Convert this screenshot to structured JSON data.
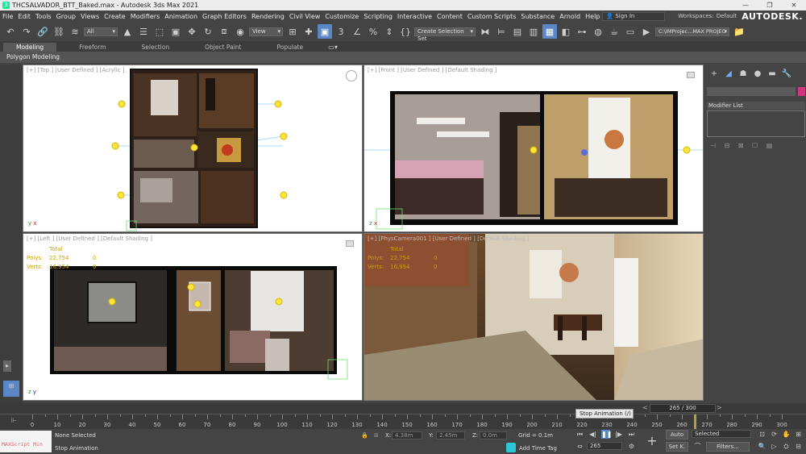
{
  "title": "THCSALVADOR_BTT_Baked.max - Autodesk 3ds Max 2021",
  "menu": [
    "File",
    "Edit",
    "Tools",
    "Group",
    "Views",
    "Create",
    "Modifiers",
    "Animation",
    "Graph Editors",
    "Rendering",
    "Civil View",
    "Customize",
    "Scripting",
    "Interactive",
    "Content",
    "Custom Scripts",
    "Substance",
    "Arnold",
    "Help"
  ],
  "sign_in": "Sign In",
  "workspaces_label": "Workspaces:",
  "workspace_value": "Default",
  "brand": "AUTODESK.",
  "toolbar": {
    "filter_value": "All",
    "ref_coord": "View",
    "selection_set": "Create Selection Set",
    "project_path": "C:\\IMProjec...MAX PROJEC"
  },
  "ribbon_tabs": [
    "Modeling",
    "Freeform",
    "Selection",
    "Object Paint",
    "Populate"
  ],
  "ribbon_sub": "Polygon Modeling",
  "viewports": {
    "top": "[+] [Top ] [User Defined ] [Acrylic ]",
    "front": "[+] [Front ] [User Defined ] [Default Shading ]",
    "left": "[+] [Left ] [User Defined ] [Default Shading ]",
    "camera": "[+] [PhysCamera001 ] [User Defined ] [Default Shading ]"
  },
  "stats": {
    "total_label": "Total",
    "polys_label": "Polys:",
    "polys": "22,754",
    "polys_sel": "0",
    "verts_label": "Verts:",
    "verts": "16,954",
    "verts_sel": "0"
  },
  "command_panel": {
    "modifier_list": "Modifier List"
  },
  "time": {
    "frame_display": "265 / 300",
    "current_frame": "265",
    "ticks": [
      "0",
      "10",
      "20",
      "30",
      "40",
      "50",
      "60",
      "70",
      "80",
      "90",
      "100",
      "110",
      "120",
      "130",
      "140",
      "150",
      "160",
      "170",
      "180",
      "190",
      "200",
      "210",
      "220",
      "230",
      "240",
      "250",
      "260",
      "270",
      "280",
      "290",
      "300"
    ],
    "frame": 265,
    "frames_total": 300
  },
  "tooltip": "Stop Animation  (/)",
  "status": {
    "maxscript": "MAXScript Min",
    "selection": "None Selected",
    "prompt": "Stop Animation",
    "x_label": "X:",
    "x": "4.38m",
    "y_label": "Y:",
    "y": "2.45m",
    "z_label": "Z:",
    "z": "0.0m",
    "grid": "Grid = 0.1m",
    "add_time_tag": "Add Time Tag",
    "auto": "Auto",
    "selected": "Selected",
    "set_key": "Set K.",
    "filters": "Filters..."
  }
}
